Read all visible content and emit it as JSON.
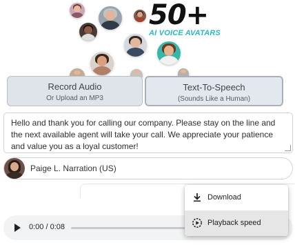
{
  "hero": {
    "count_text": "50+",
    "subtitle": "AI VOICE AVATARS",
    "accent_color": "#27b8c2"
  },
  "modes": [
    {
      "title": "Record Audio",
      "subtitle": "Or Upload an MP3",
      "active": false
    },
    {
      "title": "Text-To-Speech",
      "subtitle": "(Sounds Like a Human)",
      "active": true
    }
  ],
  "script_text": "Hello and thank you for calling our company. Please stay on the line and the next available agent will take your call. We appreciate your patience and value you as a loyal customer!",
  "voice": {
    "name": "Paige L. Narration (US)",
    "avatar_icon": "person-avatar"
  },
  "player": {
    "play_icon": "play-icon",
    "time": "0:00 / 0:08",
    "progress": 0
  },
  "menu": {
    "items": [
      {
        "label": "Download",
        "icon": "download-icon"
      },
      {
        "label": "Playback speed",
        "icon": "playback-speed-icon",
        "hovered": true
      }
    ]
  }
}
